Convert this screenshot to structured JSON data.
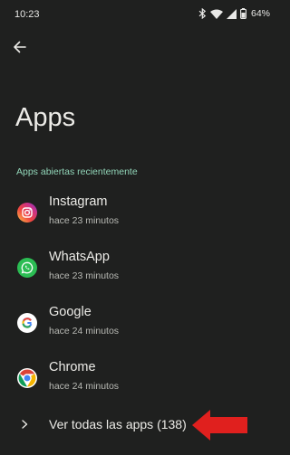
{
  "status_bar": {
    "time": "10:23",
    "icons": [
      "bluetooth-icon",
      "wifi-icon",
      "signal-icon",
      "battery-icon"
    ],
    "battery": "64%"
  },
  "header": {
    "back_icon": "arrow-back-icon",
    "title": "Apps"
  },
  "recent_section": {
    "label": "Apps abiertas recientemente",
    "apps": [
      {
        "name": "Instagram",
        "time": "hace 23 minutos",
        "icon": "instagram-icon"
      },
      {
        "name": "WhatsApp",
        "time": "hace 23 minutos",
        "icon": "whatsapp-icon"
      },
      {
        "name": "Google",
        "time": "hace 24 minutos",
        "icon": "google-icon"
      },
      {
        "name": "Chrome",
        "time": "hace 24 minutos",
        "icon": "chrome-icon"
      }
    ]
  },
  "see_all": {
    "label": "Ver todas las apps (138)",
    "icon": "chevron-right-icon"
  },
  "annotation": {
    "icon": "red-arrow-icon",
    "color": "#e0201e"
  },
  "colors": {
    "background": "#1f201f",
    "accent": "#92d6b9",
    "primary_text": "#ecebe7",
    "secondary_text": "#b8b9b4"
  }
}
